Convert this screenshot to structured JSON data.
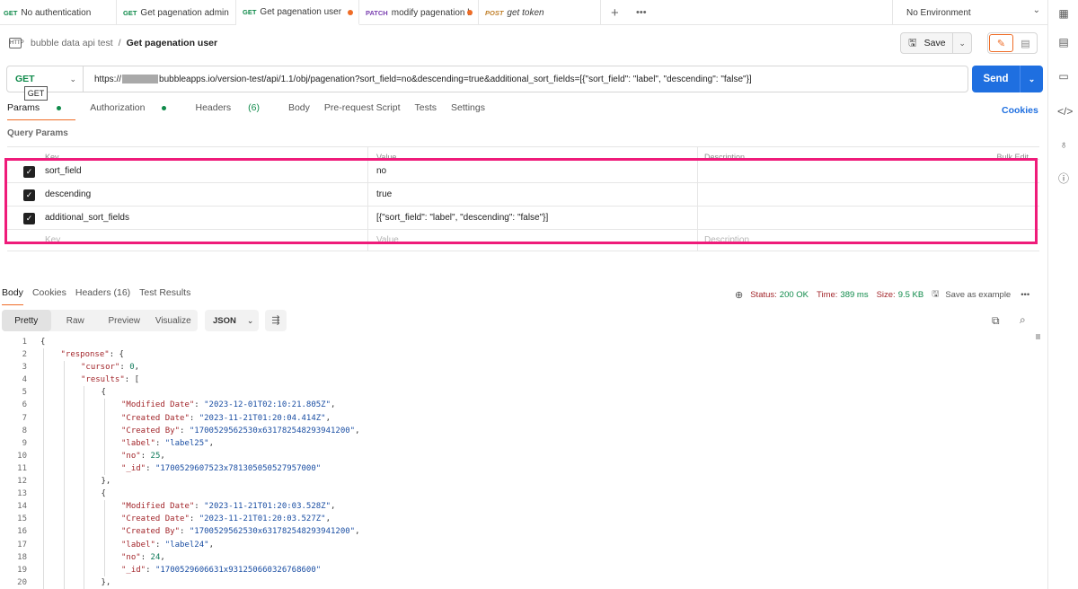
{
  "tabs": [
    {
      "method": "GET",
      "label": "No authentication",
      "dirty": false
    },
    {
      "method": "GET",
      "label": "Get pagenation admin",
      "dirty": false
    },
    {
      "method": "GET",
      "label": "Get pagenation user",
      "dirty": true,
      "active": true
    },
    {
      "method": "PATCH",
      "label": "modify pagenation b",
      "dirty": true
    },
    {
      "method": "POST",
      "label": "get token",
      "dirty": false
    }
  ],
  "environment": "No Environment",
  "breadcrumb": {
    "app_icon": "HTTP",
    "collection": "bubble data api test",
    "separator": "/",
    "request": "Get pagenation user"
  },
  "save": {
    "label": "Save"
  },
  "request": {
    "method": "GET",
    "method_tooltip": "GET",
    "url_prefix": "https://",
    "url_suffix": "bubbleapps.io/version-test/api/1.1/obj/pagenation?sort_field=no&descending=true&additional_sort_fields=[{\"sort_field\": \"label\", \"descending\": \"false\"}]"
  },
  "send": {
    "label": "Send"
  },
  "request_tabs": {
    "params": "Params",
    "authorization": "Authorization",
    "headers": "Headers",
    "headers_count": "(6)",
    "body": "Body",
    "prerequest": "Pre-request Script",
    "tests": "Tests",
    "settings": "Settings",
    "cookies": "Cookies"
  },
  "query_params": {
    "title": "Query Params",
    "headers": {
      "key": "Key",
      "value": "Value",
      "description": "Description",
      "bulk_edit": "Bulk Edit"
    },
    "rows": [
      {
        "key": "sort_field",
        "value": "no",
        "description": ""
      },
      {
        "key": "descending",
        "value": "true",
        "description": ""
      },
      {
        "key": "additional_sort_fields",
        "value": "[{\"sort_field\": \"label\", \"descending\": \"false\"}]",
        "description": ""
      }
    ],
    "placeholder": {
      "key": "Key",
      "value": "Value",
      "description": "Description"
    }
  },
  "response_tabs": {
    "body": "Body",
    "cookies": "Cookies",
    "headers": "Headers (16)",
    "tests": "Test Results"
  },
  "response_status": {
    "status_label": "Status:",
    "status_value": "200 OK",
    "time_label": "Time:",
    "time_value": "389 ms",
    "size_label": "Size:",
    "size_value": "9.5 KB",
    "save_example": "Save as example"
  },
  "body_format": {
    "pretty": "Pretty",
    "raw": "Raw",
    "preview": "Preview",
    "visualize": "Visualize",
    "language": "JSON"
  },
  "code_lines": [
    {
      "n": 1,
      "i": 0,
      "t": "{"
    },
    {
      "n": 2,
      "i": 1,
      "t": "\"response\": {"
    },
    {
      "n": 3,
      "i": 2,
      "t": "\"cursor\": 0,"
    },
    {
      "n": 4,
      "i": 2,
      "t": "\"results\": ["
    },
    {
      "n": 5,
      "i": 3,
      "t": "{"
    },
    {
      "n": 6,
      "i": 4,
      "t": "\"Modified Date\": \"2023-12-01T02:10:21.805Z\","
    },
    {
      "n": 7,
      "i": 4,
      "t": "\"Created Date\": \"2023-11-21T01:20:04.414Z\","
    },
    {
      "n": 8,
      "i": 4,
      "t": "\"Created By\": \"1700529562530x631782548293941200\","
    },
    {
      "n": 9,
      "i": 4,
      "t": "\"label\": \"label25\","
    },
    {
      "n": 10,
      "i": 4,
      "t": "\"no\": 25,"
    },
    {
      "n": 11,
      "i": 4,
      "t": "\"_id\": \"1700529607523x781305050527957000\""
    },
    {
      "n": 12,
      "i": 3,
      "t": "},"
    },
    {
      "n": 13,
      "i": 3,
      "t": "{"
    },
    {
      "n": 14,
      "i": 4,
      "t": "\"Modified Date\": \"2023-11-21T01:20:03.528Z\","
    },
    {
      "n": 15,
      "i": 4,
      "t": "\"Created Date\": \"2023-11-21T01:20:03.527Z\","
    },
    {
      "n": 16,
      "i": 4,
      "t": "\"Created By\": \"1700529562530x631782548293941200\","
    },
    {
      "n": 17,
      "i": 4,
      "t": "\"label\": \"label24\","
    },
    {
      "n": 18,
      "i": 4,
      "t": "\"no\": 24,"
    },
    {
      "n": 19,
      "i": 4,
      "t": "\"_id\": \"1700529606631x931250660326768600\""
    },
    {
      "n": 20,
      "i": 3,
      "t": "},"
    }
  ],
  "colors": {
    "accent": "#ef6c26",
    "send": "#1f6fe0",
    "highlight": "#ef1b7a",
    "get": "#0f8a4a",
    "patch": "#7a3fb0",
    "post": "#c0802b"
  }
}
